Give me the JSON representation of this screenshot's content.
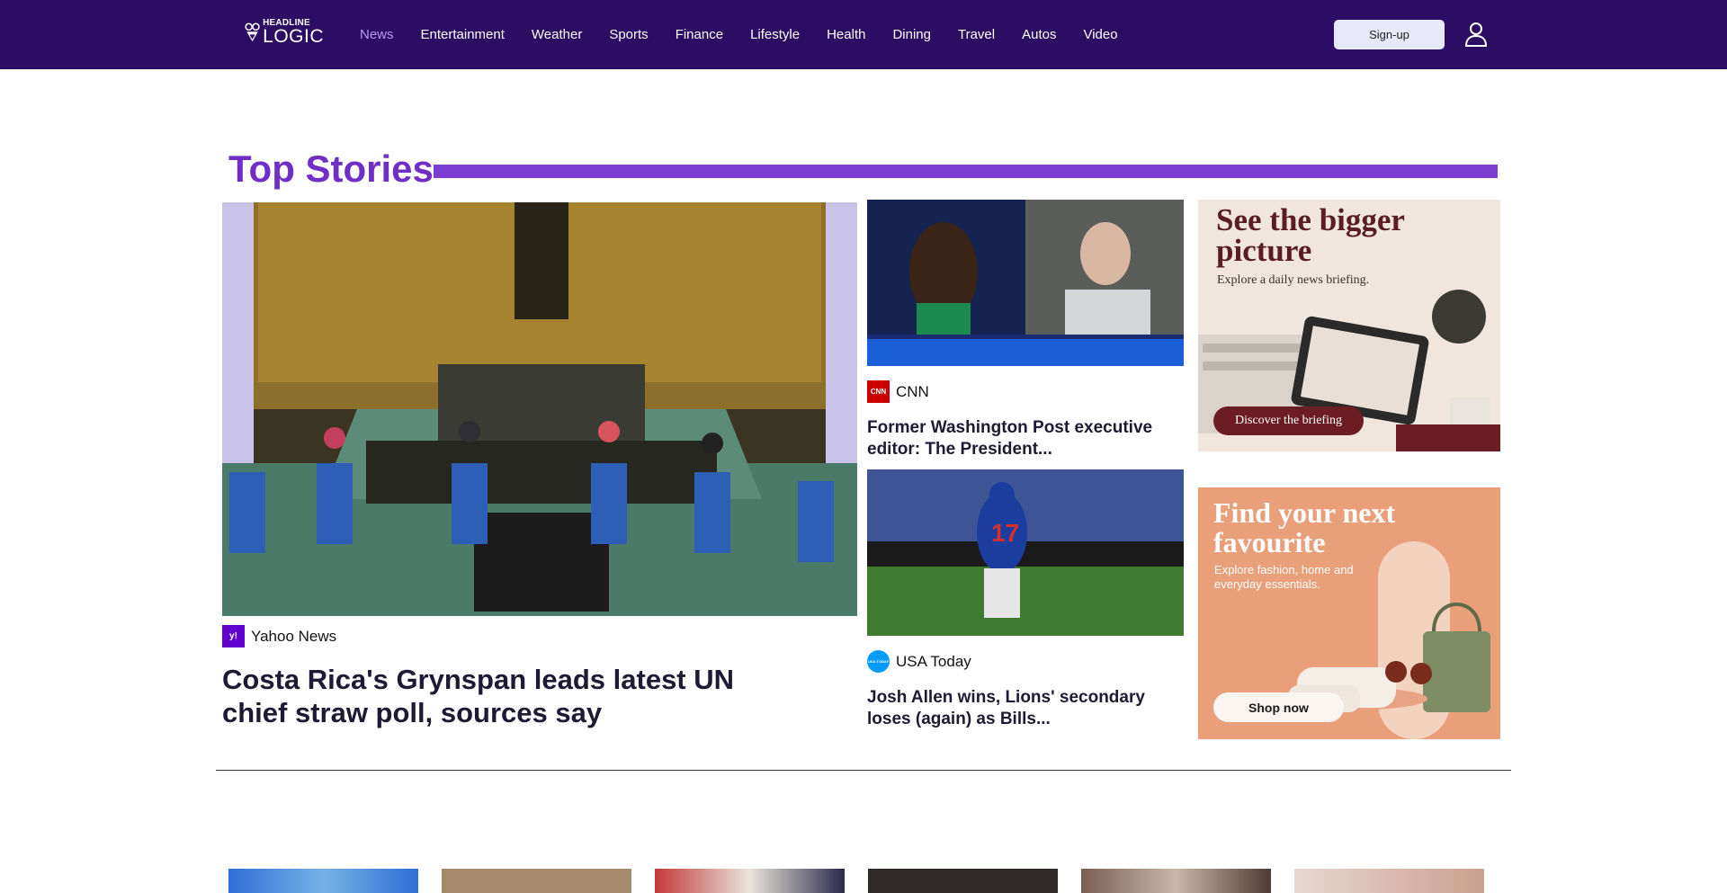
{
  "header": {
    "logo_line1": "HEADLINE",
    "logo_line2": "LOGIC",
    "nav": [
      "News",
      "Entertainment",
      "Weather",
      "Sports",
      "Finance",
      "Lifestyle",
      "Health",
      "Dining",
      "Travel",
      "Autos",
      "Video"
    ],
    "signup_label": "Sign-up",
    "accent": "#2b0d63"
  },
  "section": {
    "title": "Top Stories",
    "accent": "#7c3fd1"
  },
  "main_story": {
    "source": "Yahoo News",
    "source_logo": "y!",
    "headline": "Costa Rica's Grynspan leads latest UN chief straw poll, sources say"
  },
  "side_stories": [
    {
      "source": "CNN",
      "source_logo": "CNN",
      "headline": "Former Washington Post executive editor: The President..."
    },
    {
      "source": "USA Today",
      "source_logo": "USA TODAY",
      "headline": "Josh Allen wins, Lions' secondary loses (again) as Bills..."
    }
  ],
  "ads": [
    {
      "title": "See the bigger picture",
      "subtitle": "Explore a daily news briefing.",
      "cta": "Discover the briefing"
    },
    {
      "title": "Find your next favourite",
      "subtitle": "Explore fashion, home and everyday essentials.",
      "cta": "Shop now"
    }
  ],
  "icons": {
    "logo": "owl-logo-icon",
    "user": "user-icon"
  }
}
